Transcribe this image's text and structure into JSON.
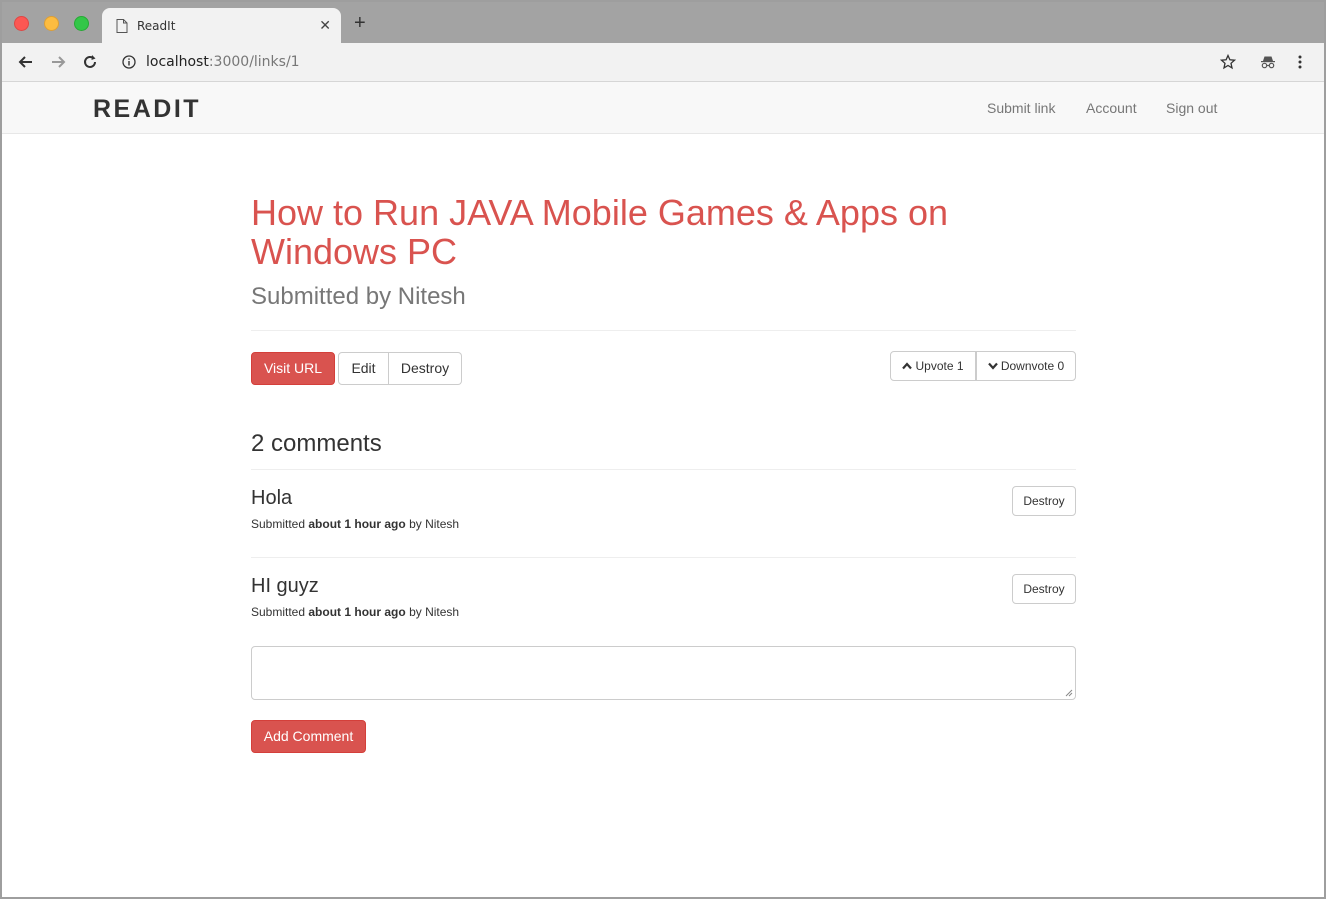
{
  "browser": {
    "tab_title": "ReadIt",
    "tab_close": "✕",
    "new_tab": "+",
    "url_host": "localhost",
    "url_path": ":3000/links/1"
  },
  "navbar": {
    "brand": "READIT",
    "links": [
      "Submit link",
      "Account",
      "Sign out"
    ]
  },
  "link": {
    "title": "How to Run JAVA Mobile Games & Apps on Windows PC",
    "submitted_by": "Submitted by Nitesh",
    "visit_label": "Visit URL",
    "edit_label": "Edit",
    "destroy_label": "Destroy",
    "upvote_label": "Upvote 1",
    "downvote_label": "Downvote 0"
  },
  "comments": {
    "count_label": "2 comments",
    "items": [
      {
        "body": "Hola",
        "meta_prefix": "Submitted",
        "meta_time": "about 1 hour ago",
        "meta_suffix": "by Nitesh",
        "destroy_label": "Destroy"
      },
      {
        "body": "HI guyz",
        "meta_prefix": "Submitted",
        "meta_time": "about 1 hour ago",
        "meta_suffix": "by Nitesh",
        "destroy_label": "Destroy"
      }
    ],
    "comment_field_value": "",
    "add_label": "Add Comment"
  },
  "colors": {
    "accent": "#d9534f",
    "navbar_bg": "#f8f8f8",
    "muted": "#777777"
  },
  "icons": [
    "document-icon",
    "back-icon",
    "forward-icon",
    "reload-icon",
    "info-icon",
    "star-icon",
    "incognito-icon",
    "menu-icon",
    "chevron-up-icon",
    "chevron-down-icon"
  ]
}
